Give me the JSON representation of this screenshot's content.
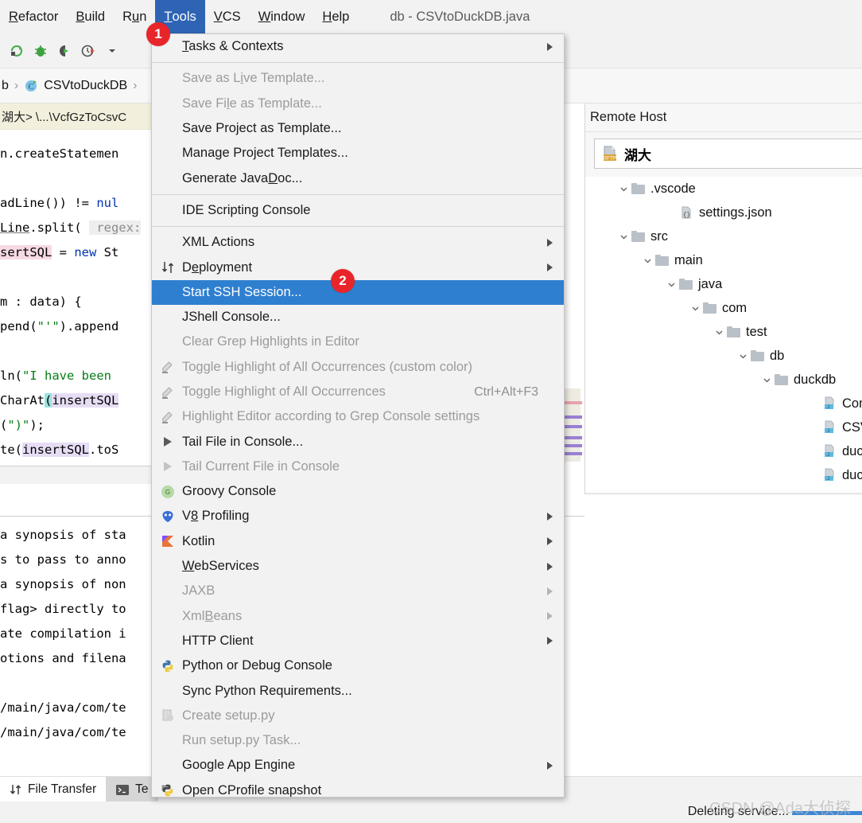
{
  "window": {
    "title": "db - CSVtoDuckDB.java"
  },
  "menubar": {
    "items": [
      {
        "label": "Refactor",
        "mnemonic": "R",
        "active": false
      },
      {
        "label": "Build",
        "mnemonic": "B",
        "active": false
      },
      {
        "label": "Run",
        "mnemonic": "u",
        "active": false
      },
      {
        "label": "Tools",
        "mnemonic": "T",
        "active": true
      },
      {
        "label": "VCS",
        "mnemonic": "V",
        "active": false
      },
      {
        "label": "Window",
        "mnemonic": "W",
        "active": false
      },
      {
        "label": "Help",
        "mnemonic": "H",
        "active": false
      }
    ]
  },
  "toolbar": {
    "icons": [
      "rerun-icon",
      "debug-icon",
      "run-with-coverage-icon",
      "profile-icon",
      "dropdown-arrow-icon"
    ]
  },
  "breadcrumb": {
    "crumb_before": "b",
    "class_name": "CSVtoDuckDB",
    "separator": "›"
  },
  "editor": {
    "annotation_line": "湖大> \\...\\VcfGzToCsvC",
    "lines": [
      "n.createStatemen",
      "adLine()) != nul",
      "Line.split( regex:",
      "sertSQL = new St",
      "m : data) {",
      "pend(\"'\").append",
      "ln(\"I have been ",
      "CharAt(insertSQL",
      "(\")\");",
      "te(insertSQL.toS"
    ],
    "console_lines": [
      "a synopsis of sta",
      "s to pass to anno",
      "a synopsis of non",
      "flag> directly to",
      "ate compilation i",
      "otions and filena",
      "/main/java/com/te",
      "/main/java/com/te"
    ]
  },
  "menu": {
    "title": "Tools",
    "items": [
      {
        "label": "Tasks & Contexts",
        "mnemonic": "T",
        "disabled": false,
        "submenu": true,
        "icon": null,
        "shortcut": null,
        "highlight": false
      },
      {
        "separator": true
      },
      {
        "label": "Save as Live Template...",
        "mnemonic": "i",
        "disabled": true,
        "submenu": false,
        "icon": null,
        "shortcut": null,
        "highlight": false
      },
      {
        "label": "Save File as Template...",
        "mnemonic": "l",
        "disabled": true,
        "submenu": false,
        "icon": null,
        "shortcut": null,
        "highlight": false
      },
      {
        "label": "Save Project as Template...",
        "disabled": false,
        "submenu": false,
        "icon": null,
        "shortcut": null,
        "highlight": false
      },
      {
        "label": "Manage Project Templates...",
        "disabled": false,
        "submenu": false,
        "icon": null,
        "shortcut": null,
        "highlight": false
      },
      {
        "label": "Generate JavaDoc...",
        "mnemonic": "D",
        "disabled": false,
        "submenu": false,
        "icon": null,
        "shortcut": null,
        "highlight": false
      },
      {
        "separator": true
      },
      {
        "label": "IDE Scripting Console",
        "disabled": false,
        "submenu": false,
        "icon": null,
        "shortcut": null,
        "highlight": false
      },
      {
        "separator": true
      },
      {
        "label": "XML Actions",
        "disabled": false,
        "submenu": true,
        "icon": null,
        "shortcut": null,
        "highlight": false
      },
      {
        "label": "Deployment",
        "mnemonic": "e",
        "disabled": false,
        "submenu": true,
        "icon": "deployment-icon",
        "shortcut": null,
        "highlight": false
      },
      {
        "label": "Start SSH Session...",
        "disabled": false,
        "submenu": false,
        "icon": null,
        "shortcut": null,
        "highlight": true
      },
      {
        "label": "JShell Console...",
        "disabled": false,
        "submenu": false,
        "icon": null,
        "shortcut": null,
        "highlight": false
      },
      {
        "label": "Clear Grep Highlights in Editor",
        "disabled": true,
        "submenu": false,
        "icon": null,
        "shortcut": null,
        "highlight": false
      },
      {
        "label": "Toggle Highlight of All Occurrences (custom color)",
        "disabled": true,
        "submenu": false,
        "icon": "highlighter-icon",
        "shortcut": null,
        "highlight": false
      },
      {
        "label": "Toggle Highlight of All Occurrences",
        "disabled": true,
        "submenu": false,
        "icon": "highlighter-icon",
        "shortcut": "Ctrl+Alt+F3",
        "highlight": false
      },
      {
        "label": "Highlight Editor according to Grep Console settings",
        "disabled": true,
        "submenu": false,
        "icon": "highlighter-icon",
        "shortcut": null,
        "highlight": false
      },
      {
        "label": "Tail File in Console...",
        "disabled": false,
        "submenu": false,
        "icon": "play-icon",
        "shortcut": null,
        "highlight": false
      },
      {
        "label": "Tail Current File in Console",
        "disabled": true,
        "submenu": false,
        "icon": "play-icon-dim",
        "shortcut": null,
        "highlight": false
      },
      {
        "label": "Groovy Console",
        "disabled": false,
        "submenu": false,
        "icon": "groovy-icon",
        "shortcut": null,
        "highlight": false
      },
      {
        "label": "V8 Profiling",
        "mnemonic": "8",
        "disabled": false,
        "submenu": true,
        "icon": "v8-icon",
        "shortcut": null,
        "highlight": false
      },
      {
        "label": "Kotlin",
        "disabled": false,
        "submenu": true,
        "icon": "kotlin-icon",
        "shortcut": null,
        "highlight": false
      },
      {
        "label": "WebServices",
        "mnemonic": "W",
        "disabled": false,
        "submenu": true,
        "icon": null,
        "shortcut": null,
        "highlight": false
      },
      {
        "label": "JAXB",
        "disabled": true,
        "submenu": true,
        "icon": null,
        "shortcut": null,
        "highlight": false
      },
      {
        "label": "XmlBeans",
        "mnemonic": "B",
        "disabled": true,
        "submenu": true,
        "icon": null,
        "shortcut": null,
        "highlight": false
      },
      {
        "label": "HTTP Client",
        "disabled": false,
        "submenu": true,
        "icon": null,
        "shortcut": null,
        "highlight": false
      },
      {
        "label": "Python or Debug Console",
        "disabled": false,
        "submenu": false,
        "icon": "python-icon",
        "shortcut": null,
        "highlight": false
      },
      {
        "label": "Sync Python Requirements...",
        "disabled": false,
        "submenu": false,
        "icon": null,
        "shortcut": null,
        "highlight": false
      },
      {
        "label": "Create setup.py",
        "disabled": true,
        "submenu": false,
        "icon": "setup-py-icon",
        "shortcut": null,
        "highlight": false
      },
      {
        "label": "Run setup.py Task...",
        "disabled": true,
        "submenu": false,
        "icon": null,
        "shortcut": null,
        "highlight": false
      },
      {
        "label": "Google App Engine",
        "disabled": false,
        "submenu": true,
        "icon": null,
        "shortcut": null,
        "highlight": false
      },
      {
        "label": "Open CProfile snapshot",
        "disabled": false,
        "submenu": false,
        "icon": "cprofile-icon",
        "shortcut": null,
        "highlight": false
      }
    ]
  },
  "badges": [
    {
      "number": "1",
      "target": "tools-menu"
    },
    {
      "number": "2",
      "target": "start-ssh-session-item"
    }
  ],
  "right_panel": {
    "header": "Remote Host",
    "connection": {
      "name": "湖大",
      "icon": "sftp-icon"
    },
    "tree": [
      {
        "label": ".vscode",
        "depth": 2,
        "type": "folder",
        "expanded": true
      },
      {
        "label": "settings.json",
        "depth": 4,
        "type": "json-file",
        "expanded": null
      },
      {
        "label": "src",
        "depth": 2,
        "type": "folder",
        "expanded": true
      },
      {
        "label": "main",
        "depth": 3,
        "type": "folder",
        "expanded": true
      },
      {
        "label": "java",
        "depth": 4,
        "type": "folder",
        "expanded": true
      },
      {
        "label": "com",
        "depth": 5,
        "type": "folder",
        "expanded": true
      },
      {
        "label": "test",
        "depth": 6,
        "type": "folder",
        "expanded": true
      },
      {
        "label": "db",
        "depth": 7,
        "type": "folder",
        "expanded": true
      },
      {
        "label": "duckdb",
        "depth": 8,
        "type": "folder",
        "expanded": true
      },
      {
        "label": "Com",
        "depth": 10,
        "type": "java-file",
        "expanded": null
      },
      {
        "label": "CSVt",
        "depth": 10,
        "type": "java-file",
        "expanded": null
      },
      {
        "label": "duck",
        "depth": 10,
        "type": "java-file",
        "expanded": null
      },
      {
        "label": "duck",
        "depth": 10,
        "type": "java-file",
        "expanded": null
      }
    ]
  },
  "bottom_tabs": [
    {
      "label": "File Transfer",
      "icon": "transfer-icon",
      "selected": true
    },
    {
      "label": "Te",
      "icon": "terminal-icon",
      "selected": false
    }
  ],
  "statusbar": {
    "message": "Deleting service...",
    "progress_percent": 100,
    "watermark": "CSDN @Ada大侦探"
  },
  "colors": {
    "menu_highlight": "#2f7fd0",
    "menubar_active": "#2f64b5",
    "badge": "#e8252a",
    "progress": "#3a87d8",
    "annotation_band": "#f2f0dd"
  }
}
